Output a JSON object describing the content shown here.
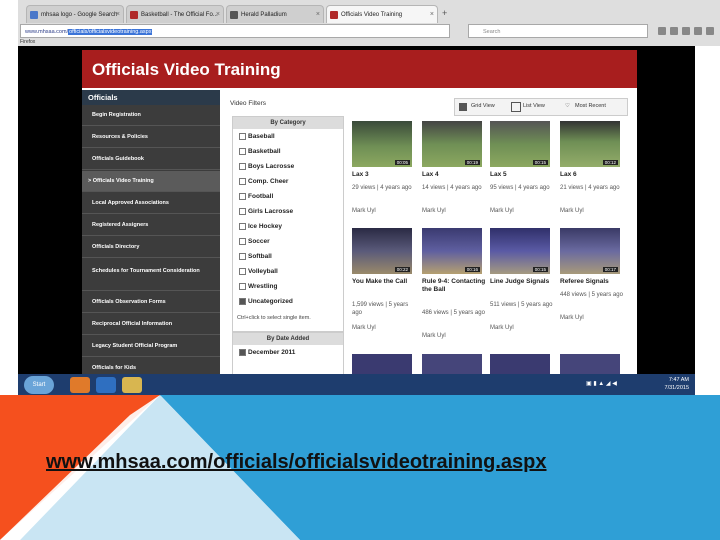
{
  "browser": {
    "tabs": [
      {
        "label": "mhsaa logo - Google Search"
      },
      {
        "label": "Basketball - The Official Fo..."
      },
      {
        "label": "Herald Palladium"
      },
      {
        "label": "Officials Video Training"
      }
    ],
    "url_prefix": "www.mhsaa.com/",
    "url_selected": "officials/officialsvideotraining.aspx",
    "search_placeholder": "Search",
    "bookmark": "Firefox"
  },
  "site": {
    "banner_title": "Officials Video Training",
    "sidebar_heading": "Officials",
    "sidebar_items": [
      "Begin Registration",
      "Resources & Policies",
      "Officials Guidebook",
      "> Officials Video Training",
      "Local Approved Associations",
      "Registered Assigners",
      "Officials Directory",
      "Schedules for Tournament Consideration",
      "Officials Observation Forms",
      "Reciprocal Official Information",
      "Legacy Student Official Program",
      "Officials for Kids"
    ],
    "video_filters_label": "Video Filters",
    "view_toggle": {
      "grid": "Grid View",
      "list": "List View",
      "sort": "Most Recent"
    },
    "filters_heading": "By Category",
    "categories": [
      "Baseball",
      "Basketball",
      "Boys Lacrosse",
      "Comp. Cheer",
      "Football",
      "Girls Lacrosse",
      "Ice Hockey",
      "Soccer",
      "Softball",
      "Volleyball",
      "Wrestling",
      "Uncategorized"
    ],
    "ctrl_hint": "Ctrl+click to select single item.",
    "date_heading": "By Date Added",
    "date_item": "December 2011",
    "videos": [
      {
        "title": "Lax 3",
        "meta": "29 views | 4 years ago",
        "author": "Mark Uyl",
        "duration": "00:05"
      },
      {
        "title": "Lax 4",
        "meta": "14 views | 4 years ago",
        "author": "Mark Uyl",
        "duration": "00:19"
      },
      {
        "title": "Lax 5",
        "meta": "95 views | 4 years ago",
        "author": "Mark Uyl",
        "duration": "00:15"
      },
      {
        "title": "Lax 6",
        "meta": "21 views | 4 years ago",
        "author": "Mark Uyl",
        "duration": "00:12"
      },
      {
        "title": "You Make the Call",
        "meta": "1,599 views | 5 years ago",
        "author": "Mark Uyl",
        "duration": "00:22"
      },
      {
        "title": "Rule 9-4: Contacting the Ball",
        "meta": "486 views | 5 years ago",
        "author": "Mark Uyl",
        "duration": "00:16"
      },
      {
        "title": "Line Judge Signals",
        "meta": "511 views | 5 years ago",
        "author": "Mark Uyl",
        "duration": "00:15"
      },
      {
        "title": "Referee Signals",
        "meta": "448 views | 5 years ago",
        "author": "Mark Uyl",
        "duration": "00:17"
      }
    ]
  },
  "taskbar": {
    "start": "Start",
    "time": "7:47 AM",
    "date": "7/31/2015"
  },
  "caption": "www.mhsaa.com/officials/officialsvideotraining.aspx",
  "colors": {
    "banner": "#a81e1e",
    "sidebar": "#3c3c3c",
    "accent_blue": "#2f9fd6",
    "accent_orange": "#f5501e"
  }
}
